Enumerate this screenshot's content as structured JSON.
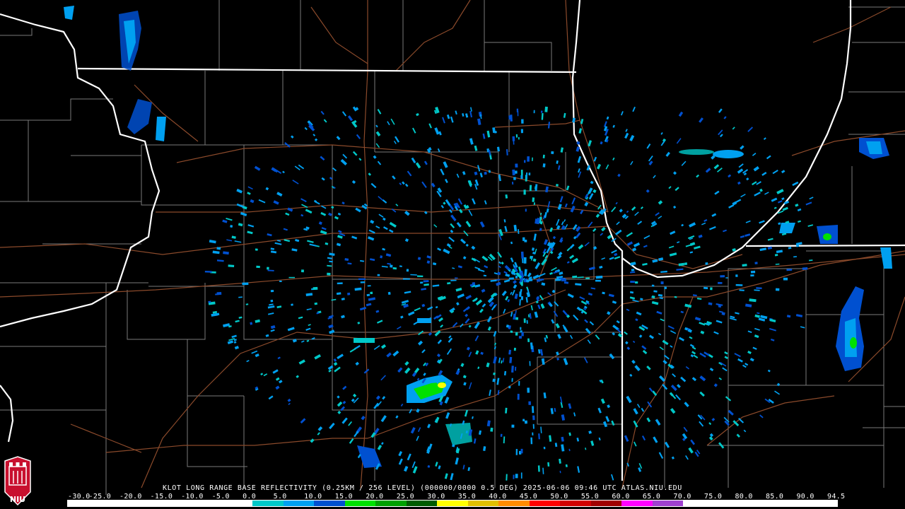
{
  "caption": {
    "text": "KLOT LONG RANGE BASE REFLECTIVITY (0.25KM / 256 LEVEL) (000000/0000 0.5 DEG) 2025-06-06 09:46 UTC  ATLAS.NIU.EDU"
  },
  "scale": {
    "labels": [
      "-30.0",
      "-25.0",
      "-20.0",
      "-15.0",
      "-10.0",
      "-5.0",
      "0.0",
      "5.0",
      "10.0",
      "15.0",
      "20.0",
      "25.0",
      "30.0",
      "35.0",
      "40.0",
      "45.0",
      "50.0",
      "55.0",
      "60.0",
      "65.0",
      "70.0",
      "75.0",
      "80.0",
      "85.0",
      "90.0",
      "94.5"
    ],
    "colors": [
      "#ffffff",
      "#ffffff",
      "#ffffff",
      "#ffffff",
      "#ffffff",
      "#ffffff",
      "#00c8c8",
      "#00a0f0",
      "#0050d0",
      "#00e000",
      "#00a000",
      "#005c00",
      "#ffff00",
      "#e0c000",
      "#ff8c00",
      "#ff0000",
      "#d00000",
      "#a00000",
      "#ff00ff",
      "#a040d0",
      "#ffffff",
      "#ffffff",
      "#ffffff",
      "#ffffff",
      "#ffffff"
    ]
  },
  "logo": {
    "text": "NIU",
    "icon": "niu-castle-icon",
    "color": "#c8102e"
  },
  "map": {
    "background": "#000000",
    "state_border_color": "#ffffff",
    "county_border_color": "#808080",
    "road_color": "#8b4a2b",
    "echo_colors": {
      "weak": "#00c8c8",
      "light": "#00a0f0",
      "moderate": "#0050d0",
      "green": "#00e000",
      "yellow": "#ffff00"
    }
  }
}
